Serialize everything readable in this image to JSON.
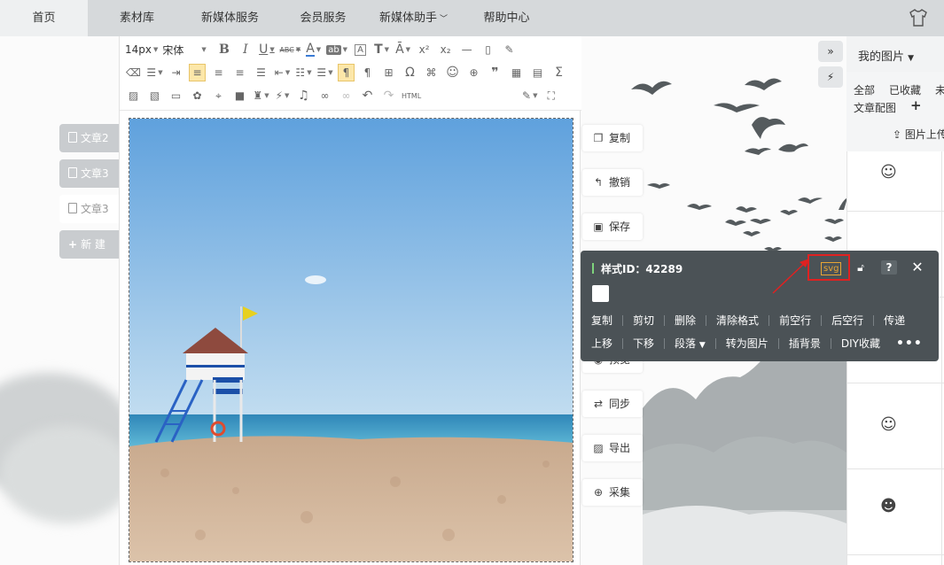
{
  "topnav": {
    "items": [
      {
        "label": "首页"
      },
      {
        "label": "素材库"
      },
      {
        "label": "新媒体服务"
      },
      {
        "label": "会员服务"
      },
      {
        "label": "新媒体助手"
      },
      {
        "label": "帮助中心"
      }
    ],
    "shirt_icon": "tshirt-icon"
  },
  "doc_tabs": [
    {
      "label": "文章2"
    },
    {
      "label": "文章3"
    },
    {
      "label": "文章3"
    },
    {
      "label": "新 建"
    }
  ],
  "toolbar": {
    "font_size": "14px",
    "font_family": "宋体",
    "html_label": "HTML"
  },
  "side_actions": [
    {
      "label": "复制"
    },
    {
      "label": "撤销"
    },
    {
      "label": "保存"
    },
    {
      "label": "预览"
    },
    {
      "label": "同步"
    },
    {
      "label": "导出"
    },
    {
      "label": "采集"
    }
  ],
  "pictures_panel": {
    "title": "我的图片",
    "filters": [
      "全部",
      "已收藏",
      "未"
    ],
    "category": "文章配图",
    "upload": "图片上传"
  },
  "popup": {
    "style_id": "样式ID：42289",
    "svg_label": "svg",
    "help": "?",
    "row1": [
      "复制",
      "剪切",
      "删除",
      "清除格式",
      "前空行",
      "后空行",
      "传递"
    ],
    "row2": [
      "上移",
      "下移",
      "段落",
      "转为图片",
      "插背景",
      "DIY收藏"
    ],
    "more": "•••"
  },
  "colors": {
    "nav_bg": "#d6d9db",
    "popup_bg": "#4b5256",
    "highlight_red": "#e02121",
    "svg_orange": "#e8a534",
    "id_bar_green": "#7ed37c"
  }
}
